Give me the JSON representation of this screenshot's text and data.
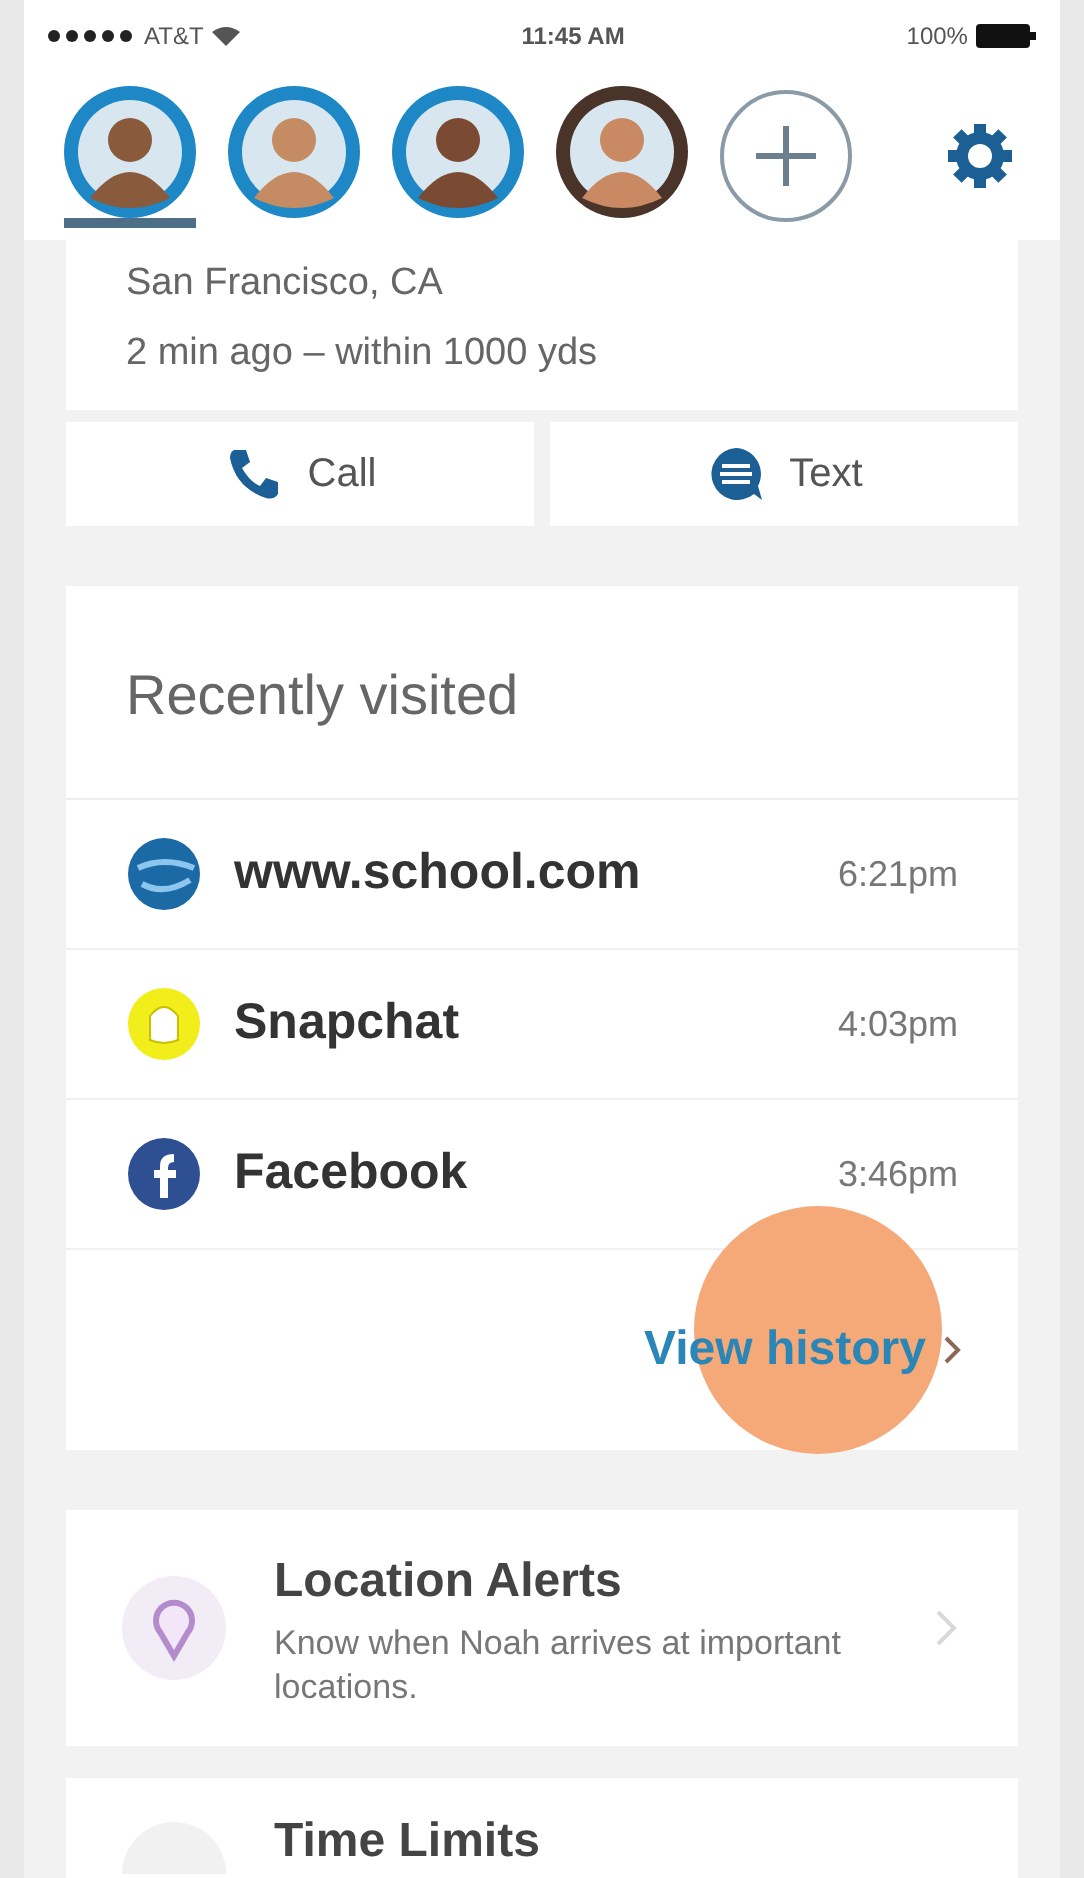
{
  "status_bar": {
    "carrier": "AT&T",
    "time": "11:45 AM",
    "battery": "100%"
  },
  "profiles": [
    {
      "selected": true
    },
    {
      "selected": false
    },
    {
      "selected": false
    },
    {
      "selected": false
    }
  ],
  "location": {
    "place": "San Francisco, CA",
    "detail": "2 min ago – within 1000 yds"
  },
  "actions": [
    {
      "kind": "call",
      "label": "Call"
    },
    {
      "kind": "text",
      "label": "Text"
    }
  ],
  "recently_visited": {
    "title": "Recently visited",
    "items": [
      {
        "kind": "web",
        "site": "www.school.com",
        "time": "6:21pm"
      },
      {
        "kind": "snapchat",
        "site": "Snapchat",
        "time": "4:03pm"
      },
      {
        "kind": "facebook",
        "site": "Facebook",
        "time": "3:46pm"
      }
    ],
    "link": "View history"
  },
  "features": [
    {
      "kind": "location",
      "title": "Location Alerts",
      "description": "Know when Noah arrives at important locations."
    },
    {
      "kind": "time",
      "title": "Time Limits"
    }
  ]
}
